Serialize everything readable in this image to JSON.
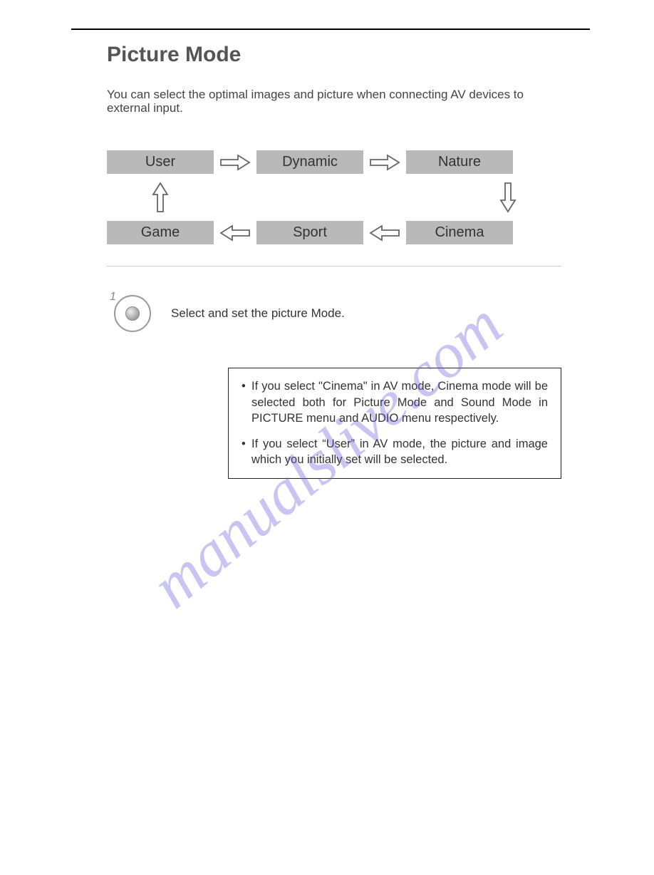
{
  "title": "Picture Mode",
  "intro": "You can select the optimal images and picture when connecting AV devices to external input.",
  "modes": {
    "top": [
      "User",
      "Dynamic",
      "Nature"
    ],
    "bottom": [
      "Game",
      "Sport",
      "Cinema"
    ]
  },
  "step": {
    "num": "1",
    "text": "Select and set the picture Mode."
  },
  "notes": [
    "If you select \"Cinema\" in AV mode, Cinema mode will be selected both for Picture Mode and Sound Mode in PICTURE menu and AUDIO menu respectively.",
    "If you select “User” in AV mode, the picture and image which you initially set will be selected."
  ],
  "watermark": "manualslive.com"
}
